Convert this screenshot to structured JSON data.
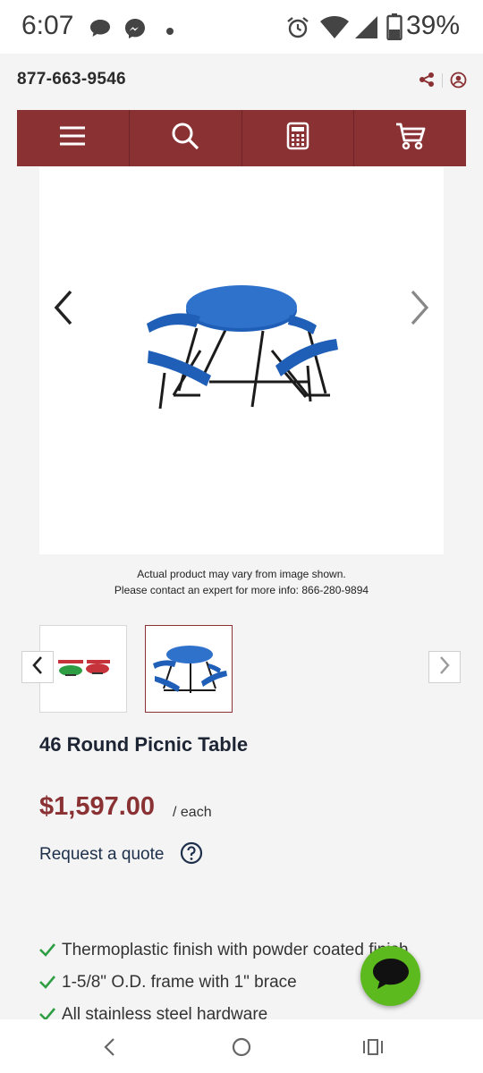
{
  "status_bar": {
    "time": "6:07",
    "battery": "39%",
    "icons": [
      "chat-bubble-icon",
      "messenger-icon",
      "dot-icon",
      "alarm-icon",
      "wifi-icon",
      "signal-icon",
      "battery-icon"
    ]
  },
  "top_bar": {
    "phone": "877-663-9546",
    "icons": [
      "share-icon",
      "user-icon"
    ]
  },
  "nav": {
    "items": [
      "menu-icon",
      "search-icon",
      "calculator-icon",
      "cart-icon"
    ]
  },
  "gallery": {
    "caption_line1": "Actual product may vary from image shown.",
    "caption_line2": "Please contact an expert for more info: 866-280-9894",
    "thumbnails": [
      "thumbnail-color-options",
      "thumbnail-blue-table"
    ],
    "active_thumbnail": 2
  },
  "product": {
    "title": "46 Round Picnic Table",
    "price": "$1,597.00",
    "unit": "/ each",
    "request_quote": "Request a quote"
  },
  "features": [
    "Thermoplastic finish with powder coated finish",
    "1-5/8\" O.D. frame with 1\" brace",
    "All stainless steel hardware"
  ],
  "colors": {
    "brand": "#8a3134",
    "chat": "#5cb91e",
    "check": "#2e9e44",
    "table_blue": "#1f5fb8"
  }
}
